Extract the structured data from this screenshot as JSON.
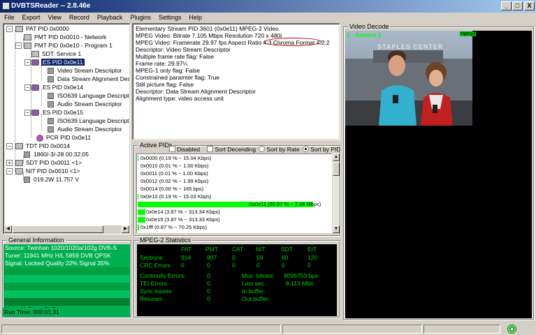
{
  "app": {
    "title": "DVBTSReader -- 2.8.46e"
  },
  "window_buttons": {
    "minimize": "_",
    "maximize": "□",
    "close": "X"
  },
  "menu": [
    "File",
    "Export",
    "View",
    "Record",
    "Playback",
    "Plugins",
    "Settings",
    "Help"
  ],
  "tree": [
    {
      "label": "PAT PID 0x0000"
    },
    {
      "label": "PMT PID 0x0010 - Network"
    },
    {
      "label": "PMT PID 0x0e10 - Program 1"
    },
    {
      "label": "SDT: Service 1"
    },
    {
      "label": "ES PID 0x0e11",
      "selected": true
    },
    {
      "label": "Video Stream Descriptor"
    },
    {
      "label": "Data Stream Alignment Descr"
    },
    {
      "label": "ES PID 0x0e14"
    },
    {
      "label": "ISO639 Language Descriptor"
    },
    {
      "label": "Audio Stream Descriptor"
    },
    {
      "label": "ES PID 0x0e15"
    },
    {
      "label": "ISO639 Language Descriptor"
    },
    {
      "label": "Audio Stream Descriptor"
    },
    {
      "label": "PCR PID 0x0e11"
    },
    {
      "label": "TDT PID 0x0014"
    },
    {
      "label": "1860/-3/-28 00:32:05"
    },
    {
      "label": "SDT PID 0x0011 <1>"
    },
    {
      "label": "NIT PID 0x0010 <1>"
    },
    {
      "label": "019.2W 11.757 V"
    }
  ],
  "details": [
    "Elementary Stream PID 3601 (0x0e11) MPEG-2 Video",
    "MPEG Video: Bitrate 7.105 Mbps Resolution 720 x 480i",
    "MPEG Video: Framerate 29.97 fps Aspect Ratio 4:3 Chroma Format 4:2:2",
    "Descriptor: Video Stream Descriptor",
    "Multiple frame rate flag: False",
    "Frame rate: 29.97¼",
    "MPEG-1 only flag: False",
    "Constrained paramter flag: True",
    "Still picture flag: False",
    "Descriptor: Data Stream Alignment Descriptor",
    "Alignment type: video access unit"
  ],
  "active_pids": {
    "title": "Active PIDs",
    "disabled_label": "Disabled",
    "sort_descending_label": "Sort Decending",
    "sort_by_rate_label": "Sort by Rate",
    "sort_by_pid_label": "Sort by PID",
    "sort_by_pid_selected": true,
    "rows": [
      {
        "label": "0x0000 (0.19 % ~ 15.04 Kbps)",
        "percent": 0.19
      },
      {
        "label": "0x0010 (0.01 % ~ 1.00 Kbps)",
        "percent": 0.01
      },
      {
        "label": "0x0011 (0.01 % ~ 1.00 Kbps)",
        "percent": 0.01
      },
      {
        "label": "0x0012 (0.02 % ~ 1.99 Kbps)",
        "percent": 0.02
      },
      {
        "label": "0x0014 (0.00 % ~ 165 bps)",
        "percent": 0.0
      },
      {
        "label": "0x0e10 (0.19 % ~ 15.03 Kbps)",
        "percent": 0.19
      },
      {
        "label": "0x0e11 (90.97 % ~ 7.38 Mbps)",
        "percent": 90.97
      },
      {
        "label": "0x0e14 (3.87 % ~ 313.34 Kbps)",
        "percent": 3.87
      },
      {
        "label": "0x0e15 (3.87 % ~ 313.33 Kbps)",
        "percent": 3.87
      },
      {
        "label": "0x1fff (0.87 % ~ 70.25 Kbps)",
        "percent": 0.87
      }
    ]
  },
  "general_info": {
    "title": "General Information",
    "rows": [
      "Source: Twinhan 1020/1020a/102g DVB-S",
      "Tuner: 11941 MHz H/L 5859 DVB QPSK",
      "Signal: Locked Quality 22% Signal 35%",
      "",
      "",
      "",
      "",
      "",
      "Network Type: DVB",
      "Run Time: 000:01:31"
    ]
  },
  "mpeg2_stats": {
    "title": "MPEG-2 Statistics",
    "columns": [
      "PAT",
      "PMT",
      "CAT",
      "NIT",
      "SDT",
      "EIT"
    ],
    "sections_label": "Sections",
    "sections": [
      "914",
      "907",
      "0",
      "59",
      "60",
      "120"
    ],
    "crc_label": "CRC Errors",
    "crc": [
      "0",
      "0",
      "0",
      "0",
      "0",
      "0"
    ],
    "continuity_label": "Continuity Errors:",
    "continuity": "0",
    "tei_label": "TEI Errors:",
    "tei": "0",
    "sync_label": "Sync losses:",
    "sync": "0",
    "retunes_label": "Retunes:",
    "retunes": "0",
    "mux_label": "Mux. bitrate:",
    "mux": "8099753 bps",
    "last_label": "Last sec.:",
    "last": "8.113 Mbit",
    "inbuf_label": "In buffer:",
    "inbuf": "",
    "outbuf_label": "Out buffer:",
    "outbuf": ""
  },
  "video_decode": {
    "title": "Video Decode",
    "service": "1 - Service 1",
    "codec_badge": "mpeg2",
    "banner_text": "STAPLES CENTER"
  },
  "colors": {
    "accent": "#00ff00",
    "title_blue": "#0a246a",
    "annotation": "#c00000"
  }
}
